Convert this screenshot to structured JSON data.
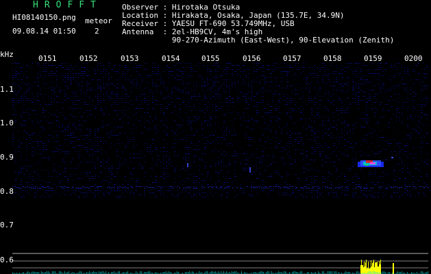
{
  "header": {
    "brand": "HROFFT",
    "filename": "HI08140150.png",
    "meteor_label": "meteor",
    "datetime": "09.08.14 01:50",
    "meteor_count": "2"
  },
  "station_info": {
    "observer": "Observer : Hirotaka Otsuka",
    "location": "Location : Hirakata, Osaka, Japan (135.7E, 34.9N)",
    "receiver": "Receiver : YAESU FT-690 53.749MHz, USB",
    "antenna": "Antenna  : 2el-HB9CV, 4m's high",
    "antenna_detail": "           90-270-Azimuth (East-West), 90-Elevation (Zenith)"
  },
  "axis": {
    "y_unit": "kHz",
    "x_ticks": [
      "0151",
      "0152",
      "0153",
      "0154",
      "0155",
      "0156",
      "0157",
      "0158",
      "0159",
      "0200"
    ],
    "y_ticks": [
      "1.1",
      "1.0",
      "0.9",
      "0.8",
      "0.7",
      "0.6"
    ]
  },
  "colors": {
    "background": "#000000",
    "text": "#ffffff",
    "brand_green": "#37e27b",
    "noise_blue": "#0a14a8",
    "baseline_yellow": "#ffff00",
    "signal_cyan": "#00e0e0",
    "reference_line": "#b4b4b4"
  }
}
